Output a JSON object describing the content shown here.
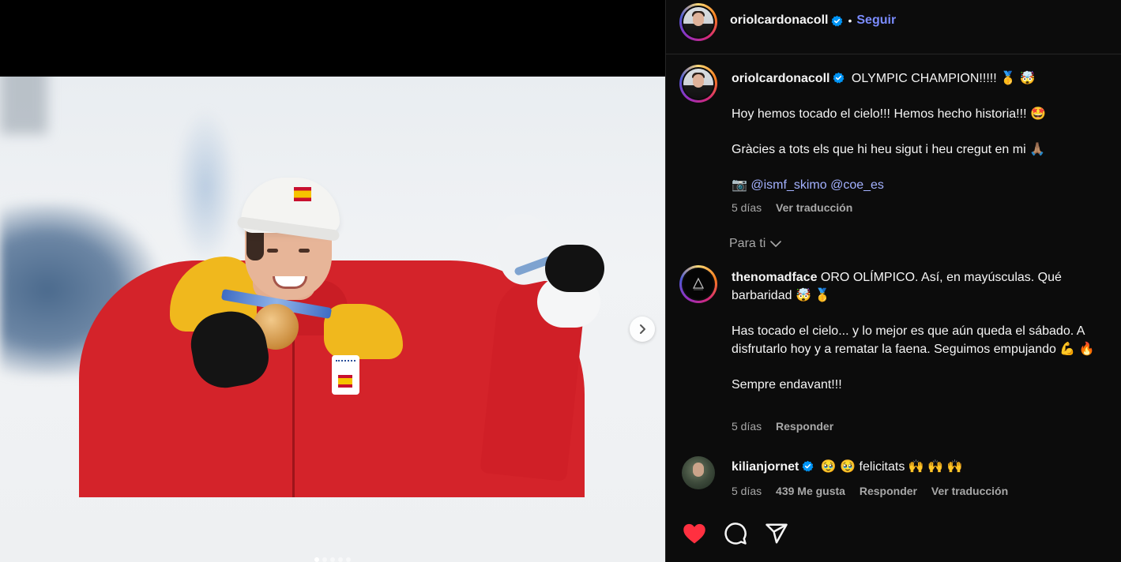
{
  "post_author": {
    "username": "oriolcardonacoll",
    "separator": "•",
    "follow_label": "Seguir"
  },
  "caption": {
    "username": "oriolcardonacoll",
    "line1": "OLYMPIC CHAMPION!!!!! 🥇 🤯",
    "line2": "Hoy hemos tocado el cielo!!! Hemos hecho historia!!! 🤩",
    "line3": "Gràcies a tots els que hi heu sigut i heu cregut en mi 🙏🏽",
    "camera": "📷",
    "mention1": "@ismf_skimo",
    "mention2": "@coe_es",
    "time": "5 días",
    "translate_label": "Ver traducción"
  },
  "section": {
    "label": "Para ti"
  },
  "comments": [
    {
      "username": "thenomadface",
      "text1": "ORO OLÍMPICO. Así, en mayúsculas. Qué barbaridad 🤯 🥇",
      "text2": "Has tocado el cielo... y lo mejor es que aún queda el sábado. A disfrutarlo hoy y a rematar la faena. Seguimos empujando 💪 🔥",
      "text3": "Sempre endavant!!!",
      "time": "5 días",
      "reply_label": "Responder"
    },
    {
      "username": "kilianjornet",
      "text": "🥹 🥹 felicitats 🙌 🙌 🙌",
      "time": "5 días",
      "likes": "439 Me gusta",
      "reply_label": "Responder",
      "translate_label": "Ver traducción"
    }
  ],
  "carousel": {
    "total_slides": 5,
    "active_slide": 1
  },
  "colors": {
    "accent_link": "#7b8cff",
    "like_red": "#ff3040",
    "verified_blue": "#0095f6",
    "panel_bg": "#0c0c0c"
  },
  "icons": [
    "verified-icon",
    "chevron-right-icon",
    "chevron-down-icon",
    "heart-icon",
    "comment-icon",
    "share-icon"
  ]
}
